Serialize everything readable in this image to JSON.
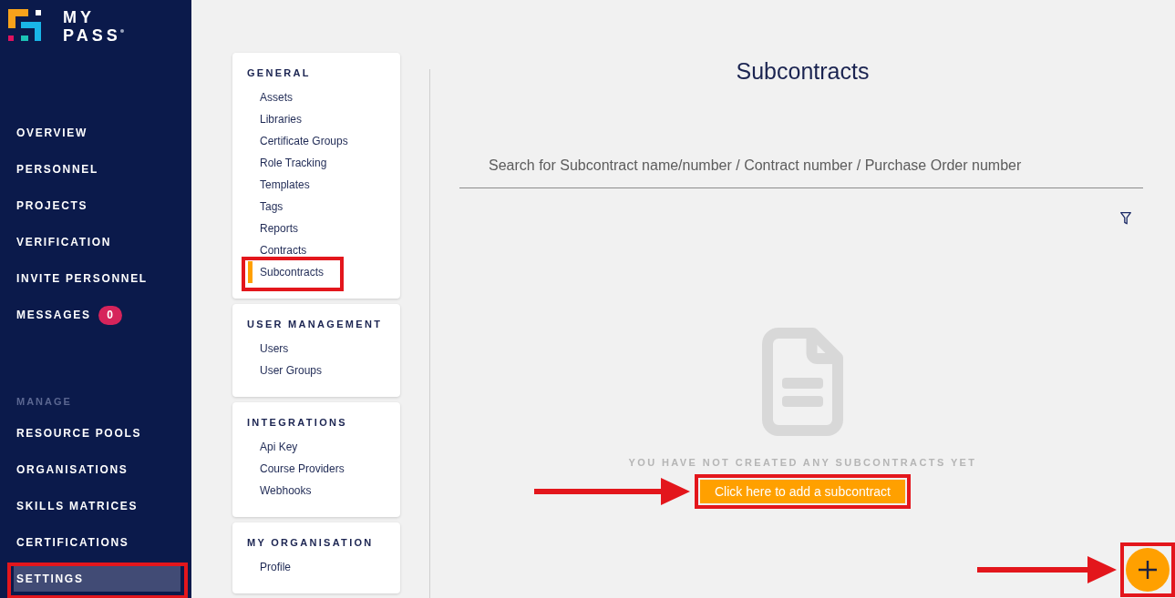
{
  "sidebar": {
    "brand": {
      "line_1": "MY",
      "line_2": "PASS"
    },
    "nav": [
      {
        "label": "OVERVIEW",
        "selected": false,
        "annotated": false
      },
      {
        "label": "PERSONNEL",
        "selected": false,
        "annotated": false
      },
      {
        "label": "PROJECTS",
        "selected": false,
        "annotated": false
      },
      {
        "label": "VERIFICATION",
        "selected": false,
        "annotated": false
      },
      {
        "label": "INVITE PERSONNEL",
        "selected": false,
        "annotated": false
      },
      {
        "label": "MESSAGES",
        "badge": "0",
        "selected": false,
        "annotated": false
      }
    ],
    "section_label": "MANAGE",
    "manage_nav": [
      {
        "label": "RESOURCE POOLS",
        "selected": false,
        "annotated": false
      },
      {
        "label": "ORGANISATIONS",
        "selected": false,
        "annotated": false
      },
      {
        "label": "SKILLS MATRICES",
        "selected": false,
        "annotated": false
      },
      {
        "label": "CERTIFICATIONS",
        "selected": false,
        "annotated": false
      },
      {
        "label": "SETTINGS",
        "selected": true,
        "annotated": true
      }
    ]
  },
  "settings_menu": [
    {
      "heading": "GENERAL",
      "items": [
        {
          "label": "Assets",
          "selected": false,
          "annotated": false
        },
        {
          "label": "Libraries",
          "selected": false,
          "annotated": false
        },
        {
          "label": "Certificate Groups",
          "selected": false,
          "annotated": false
        },
        {
          "label": "Role Tracking",
          "selected": false,
          "annotated": false
        },
        {
          "label": "Templates",
          "selected": false,
          "annotated": false
        },
        {
          "label": "Tags",
          "selected": false,
          "annotated": false
        },
        {
          "label": "Reports",
          "selected": false,
          "annotated": false
        },
        {
          "label": "Contracts",
          "selected": false,
          "annotated": false
        },
        {
          "label": "Subcontracts",
          "selected": true,
          "annotated": true
        }
      ]
    },
    {
      "heading": "USER MANAGEMENT",
      "items": [
        {
          "label": "Users",
          "selected": false,
          "annotated": false
        },
        {
          "label": "User Groups",
          "selected": false,
          "annotated": false
        }
      ]
    },
    {
      "heading": "INTEGRATIONS",
      "items": [
        {
          "label": "Api Key",
          "selected": false,
          "annotated": false
        },
        {
          "label": "Course Providers",
          "selected": false,
          "annotated": false
        },
        {
          "label": "Webhooks",
          "selected": false,
          "annotated": false
        }
      ]
    },
    {
      "heading": "MY ORGANISATION",
      "items": [
        {
          "label": "Profile",
          "selected": false,
          "annotated": false
        }
      ]
    }
  ],
  "content": {
    "title": "Subcontracts",
    "search": {
      "placeholder": "Search for Subcontract name/number / Contract number / Purchase Order number"
    },
    "empty_state": {
      "message": "YOU HAVE NOT CREATED ANY SUBCONTRACTS YET",
      "button": {
        "label": "Click here to add a subcontract",
        "annotated": true,
        "arrow": true
      }
    },
    "fab": {
      "annotated": true,
      "arrow": true
    }
  }
}
